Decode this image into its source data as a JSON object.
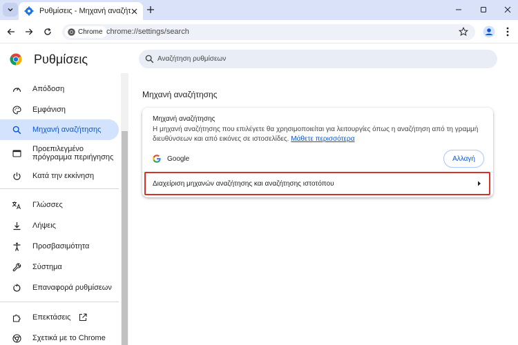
{
  "browser": {
    "tab_title": "Ρυθμίσεις - Μηχανή αναζήτησης",
    "chip_label": "Chrome",
    "url": "chrome://settings/search"
  },
  "settings": {
    "title": "Ρυθμίσεις",
    "search_placeholder": "Αναζήτηση ρυθμίσεων"
  },
  "sidebar": {
    "items": [
      {
        "label": "Απόδοση",
        "icon": "speedometer-icon"
      },
      {
        "label": "Εμφάνιση",
        "icon": "palette-icon"
      },
      {
        "label": "Μηχανή αναζήτησης",
        "icon": "search-icon",
        "active": true
      },
      {
        "label": "Προεπιλεγμένο πρόγραμμα περιήγησης",
        "icon": "browser-window-icon"
      },
      {
        "label": "Κατά την εκκίνηση",
        "icon": "power-icon"
      },
      {
        "label": "Γλώσσες",
        "icon": "translate-icon"
      },
      {
        "label": "Λήψεις",
        "icon": "download-icon"
      },
      {
        "label": "Προσβασιμότητα",
        "icon": "accessibility-icon"
      },
      {
        "label": "Σύστημα",
        "icon": "wrench-icon"
      },
      {
        "label": "Επαναφορά ρυθμίσεων",
        "icon": "reset-icon"
      },
      {
        "label": "Επεκτάσεις",
        "icon": "puzzle-icon"
      },
      {
        "label": "Σχετικά με το Chrome",
        "icon": "chrome-icon"
      }
    ]
  },
  "main": {
    "section_heading": "Μηχανή αναζήτησης",
    "card": {
      "title": "Μηχανή αναζήτησης",
      "description": "Η μηχανή αναζήτησης που επιλέγετε θα χρησιμοποιείται για λειτουργίες όπως η αναζήτηση από τη γραμμή διευθύνσεων και από εικόνες σε ιστοσελίδες.",
      "learn_more": "Μάθετε περισσότερα",
      "engine_name": "Google",
      "change_button": "Αλλαγή",
      "manage_label": "Διαχείριση μηχανών αναζήτησης και αναζήτησης ιστοτόπου"
    }
  },
  "colors": {
    "accent": "#0b57d0",
    "tabstrip": "#dae2f9",
    "active_nav": "#d3e3fd",
    "highlight": "#d93025"
  }
}
